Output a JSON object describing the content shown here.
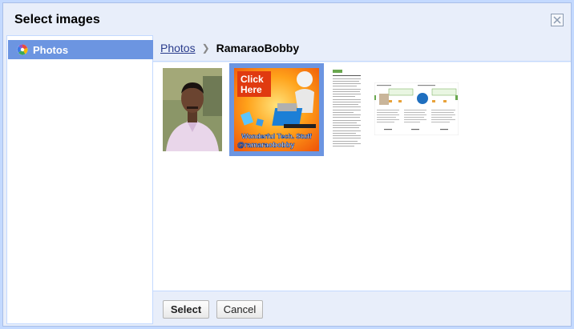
{
  "dialog": {
    "title": "Select images"
  },
  "sidebar": {
    "items": [
      {
        "label": "Photos",
        "icon": "picasa-icon",
        "selected": true
      }
    ]
  },
  "breadcrumb": {
    "link": "Photos",
    "current": "RamaraoBobby"
  },
  "thumbnails": [
    {
      "name": "portrait-photo",
      "selected": false
    },
    {
      "name": "click-here-promo",
      "selected": true,
      "text_line1": "Click",
      "text_line2": "Here",
      "caption1": "Wonderful Tech. Stuff",
      "caption2": "@ramaraobobby"
    },
    {
      "name": "document-page",
      "selected": false
    },
    {
      "name": "blog-screenshot",
      "selected": false
    }
  ],
  "footer": {
    "select_label": "Select",
    "cancel_label": "Cancel"
  },
  "colors": {
    "accent": "#6c95e1",
    "frame": "#c3d9ff",
    "panel": "#e8eefa"
  }
}
